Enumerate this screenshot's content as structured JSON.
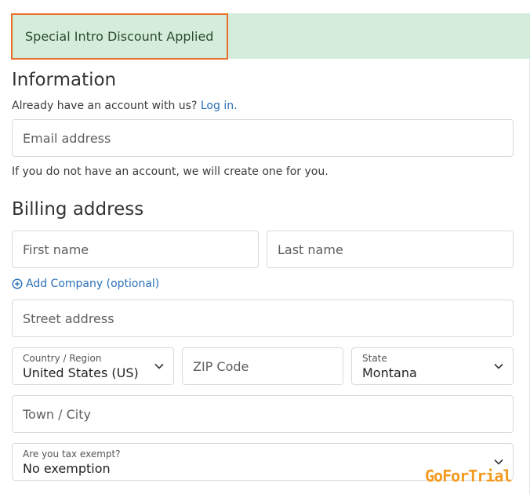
{
  "banner": {
    "text": "Special Intro Discount Applied"
  },
  "information": {
    "heading": "Information",
    "account_prompt": "Already have an account with us?",
    "login_link": "Log in.",
    "email_placeholder": "Email address",
    "no_account_note": "If you do not have an account, we will create one for you."
  },
  "billing": {
    "heading": "Billing address",
    "first_name_placeholder": "First name",
    "last_name_placeholder": "Last name",
    "add_company": "Add Company (optional)",
    "street_placeholder": "Street address",
    "country": {
      "label": "Country / Region",
      "value": "United States (US)"
    },
    "zip_placeholder": "ZIP Code",
    "state": {
      "label": "State",
      "value": "Montana"
    },
    "city_placeholder": "Town / City",
    "tax": {
      "label": "Are you tax exempt?",
      "value": "No exemption"
    }
  },
  "watermark": "GoForTrial",
  "colors": {
    "banner_bg": "#d4ecda",
    "highlight_border": "#e8702a",
    "link": "#2a6fb8",
    "watermark": "#f39a1e"
  },
  "icons": [
    "plus-circle-icon",
    "chevron-down-icon"
  ]
}
